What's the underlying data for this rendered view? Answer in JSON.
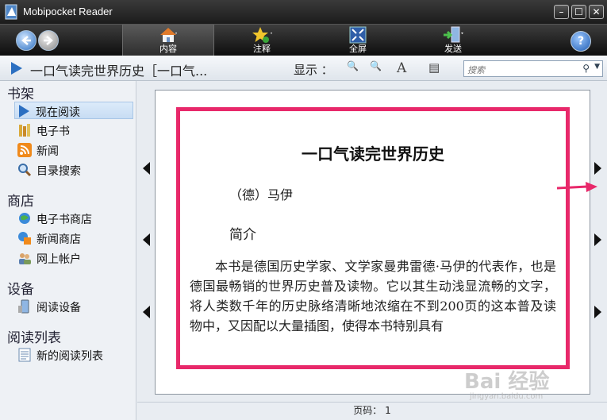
{
  "window": {
    "title": "Mobipocket Reader",
    "min": "–",
    "max": "☐",
    "close": "✕"
  },
  "toolbar": {
    "content": "内容",
    "annotate": "注释",
    "fullscreen": "全屏",
    "send": "发送",
    "help": "?"
  },
  "docbar": {
    "title": "一口气读完世界历史［一口气...",
    "show_label": "显示 ：",
    "zoom_out": "🔍",
    "zoom_in": "🔍",
    "font": "A",
    "layout": "▤",
    "search_placeholder": "搜索"
  },
  "sidebar": {
    "sections": [
      {
        "label": "书架",
        "items": [
          "现在阅读",
          "电子书",
          "新闻",
          "目录搜索"
        ]
      },
      {
        "label": "商店",
        "items": [
          "电子书商店",
          "新闻商店",
          "网上帐户"
        ]
      },
      {
        "label": "设备",
        "items": [
          "阅读设备"
        ]
      },
      {
        "label": "阅读列表",
        "items": [
          "新的阅读列表"
        ]
      }
    ]
  },
  "book": {
    "heading": "一口气读完世界历史",
    "author": "（德）马伊",
    "intro_label": "简介",
    "body": "本书是德国历史学家、文学家曼弗雷德·马伊的代表作，也是德国最畅销的世界历史普及读物。它以其生动浅显流畅的文字，将人类数千年的历史脉络清晰地浓缩在不到200页的这本普及读物中，又因配以大量插图，使得本书特别具有"
  },
  "status": {
    "page": "页码： 1"
  },
  "watermark": {
    "text": "Bai 经验",
    "sub": "jingyan.baidu.com"
  },
  "colors": {
    "highlight": "#e8286a",
    "accent": "#2b6fc1"
  }
}
